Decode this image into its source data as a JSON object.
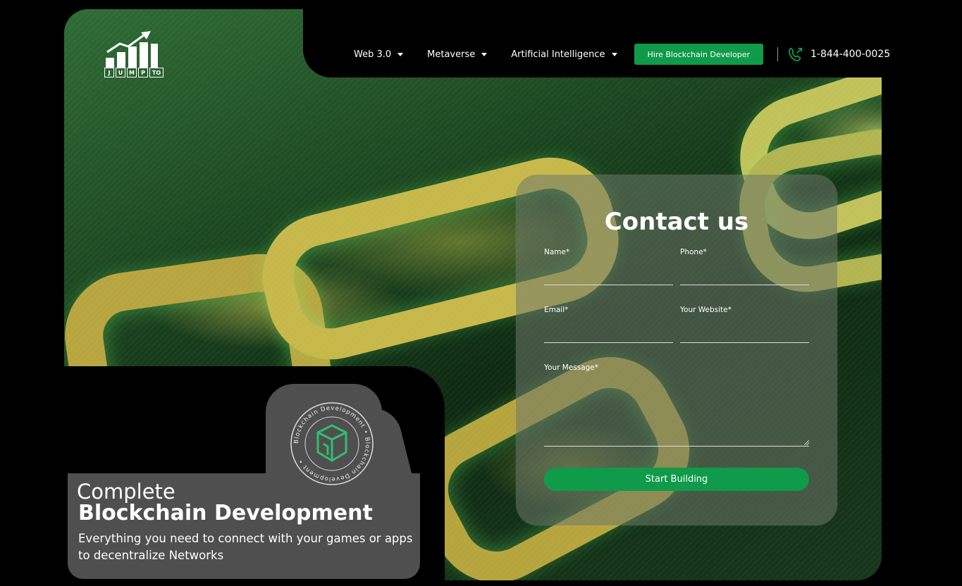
{
  "brand": {
    "logo_letters": [
      "J",
      "U",
      "M",
      "P",
      "TO"
    ]
  },
  "nav": {
    "items": [
      {
        "label": "Web 3.0"
      },
      {
        "label": "Metaverse"
      },
      {
        "label": "Artificial Intelligence"
      }
    ],
    "hire_button": "Hire Blockchain Developer",
    "phone": "1-844-400-0025",
    "phone_icon": "phone-icon"
  },
  "contact_form": {
    "title": "Contact us",
    "fields": {
      "name": "Name*",
      "phone": "Phone*",
      "email": "Email*",
      "website": "Your Website*",
      "message": "Your Message*"
    },
    "submit": "Start Building"
  },
  "hero_card": {
    "line1": "Complete",
    "line2": "Blockchain Development",
    "description": "Everything you need to connect with your games or apps to decentralize Networks",
    "badge_text": "Blockchain Development • Blockchain Development •"
  },
  "colors": {
    "accent": "#0f9b4a",
    "card_bg": "#4f4f4f",
    "page_bg": "#000000"
  }
}
